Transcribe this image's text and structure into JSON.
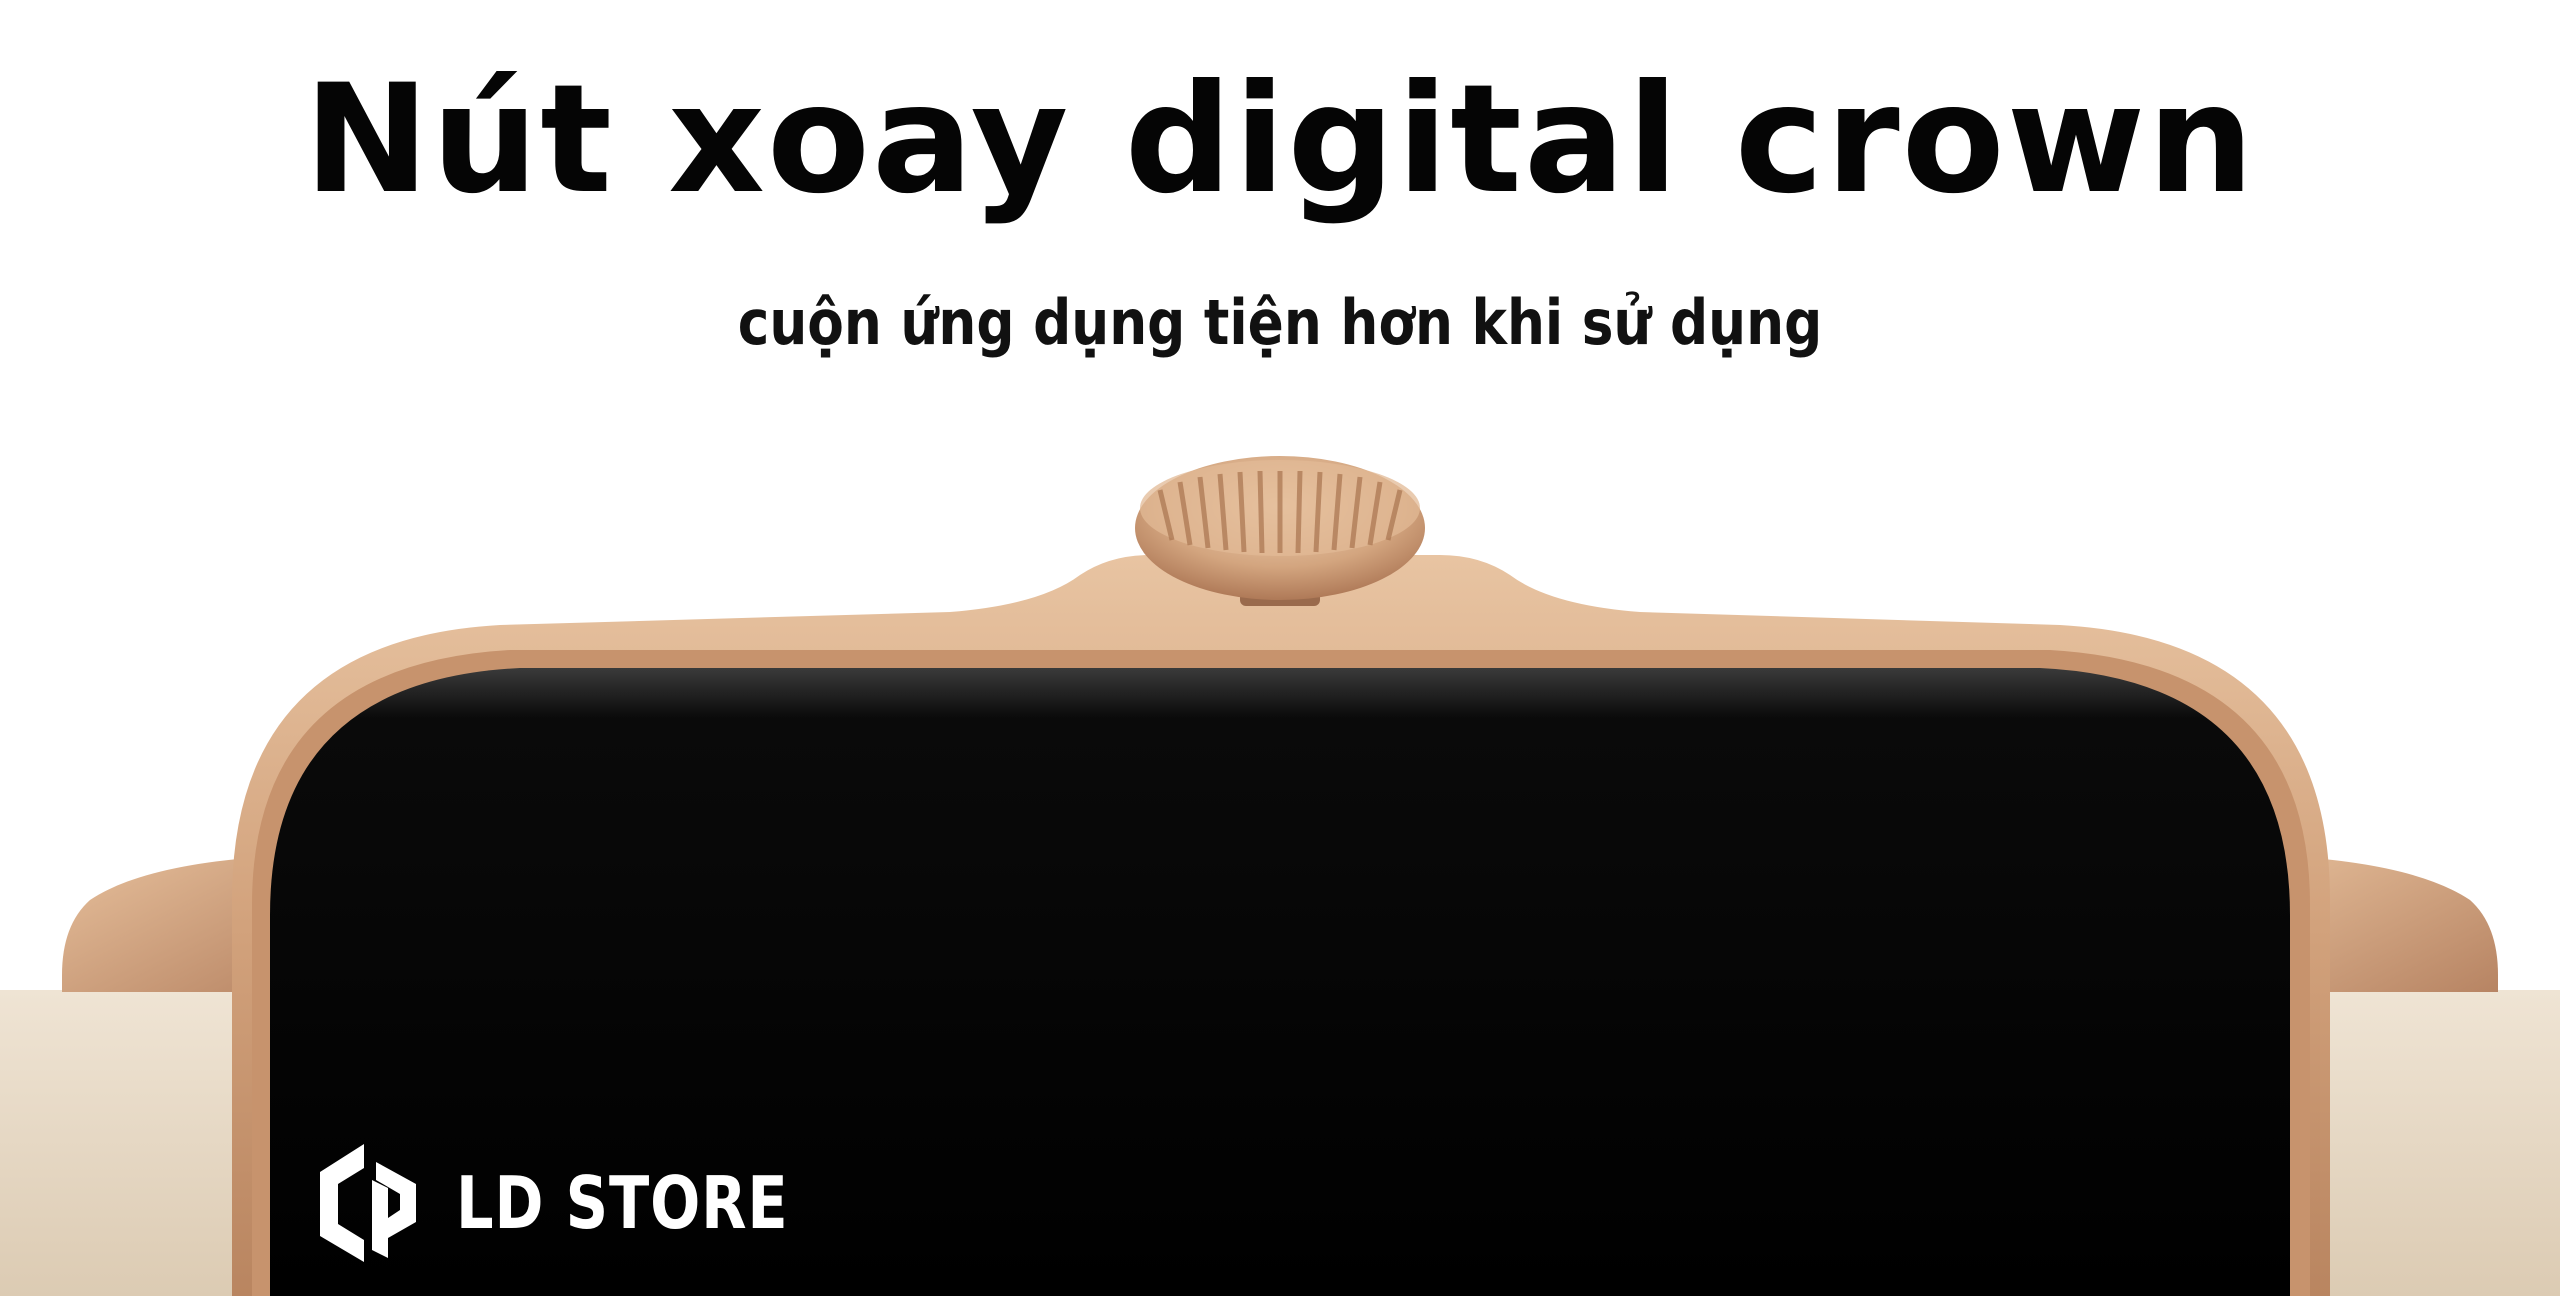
{
  "headline": "Nút xoay digital crown",
  "subheadline": "cuộn ứng dụng tiện hơn khi sử dụng",
  "brand": {
    "name": "LD STORE",
    "logo_icon": "ld-hexagon-logo-icon"
  },
  "colors": {
    "background": "#ffffff",
    "text": "#050505",
    "case_gold": "#d4a883",
    "screen": "#000000",
    "strap": "#e6d8c5"
  }
}
